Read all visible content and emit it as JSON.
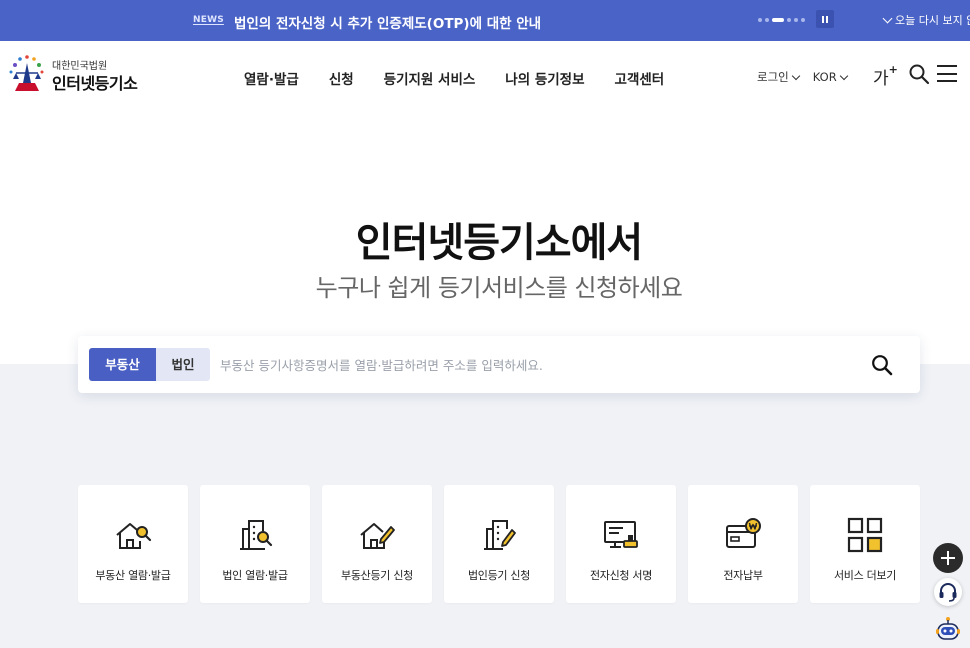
{
  "newsbar": {
    "tag": "NEWS",
    "text": "법인의 전자신청 시 추가 인증제도(OTP)에 대한 안내",
    "today_close": "오늘 다시 보지 않",
    "slides": 6,
    "active_slide": 2
  },
  "header": {
    "logo_sub": "대한민국법원",
    "logo_main": "인터넷등기소",
    "nav": [
      "열람·발급",
      "신청",
      "등기지원 서비스",
      "나의 등기정보",
      "고객센터"
    ],
    "login": "로그인",
    "language": "KOR",
    "font_size_label": "가",
    "font_size_plus": "+"
  },
  "hero": {
    "title": "인터넷등기소에서",
    "subtitle": "누구나 쉽게 등기서비스를 신청하세요"
  },
  "search": {
    "tabs": [
      "부동산",
      "법인"
    ],
    "active_tab": "부동산",
    "placeholder": "부동산 등기사항증명서를 열람·발급하려면 주소를 입력하세요.",
    "value": ""
  },
  "services": [
    {
      "label": "부동산 열람·발급",
      "icon": "house-search-icon"
    },
    {
      "label": "법인 열람·발급",
      "icon": "building-search-icon"
    },
    {
      "label": "부동산등기 신청",
      "icon": "house-pen-icon"
    },
    {
      "label": "법인등기 신청",
      "icon": "building-pen-icon"
    },
    {
      "label": "전자신청 서명",
      "icon": "monitor-stamp-icon"
    },
    {
      "label": "전자납부",
      "icon": "wallet-won-icon"
    },
    {
      "label": "서비스 더보기",
      "icon": "grid-icon"
    }
  ],
  "colors": {
    "primary": "#4a63c7",
    "tab_active": "#4a5fc3",
    "accent_yellow": "#f2c12e",
    "hero_bg": "#f0f2f6"
  }
}
